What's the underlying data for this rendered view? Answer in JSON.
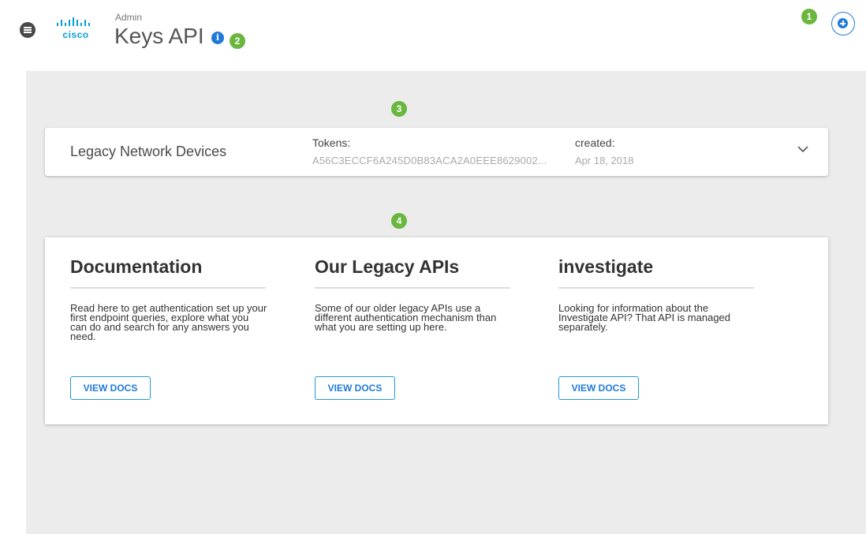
{
  "header": {
    "logo_text": "cisco",
    "section_label": "Admin",
    "title": "Keys API",
    "info_icon": "i",
    "menu_icon": "hamburger-menu-icon",
    "add_icon": "plus-circle-icon",
    "badges": [
      "1",
      "2"
    ]
  },
  "steps": [
    "3",
    "4"
  ],
  "key_row": {
    "name": "Legacy Network Devices",
    "tokens_label": "Tokens:",
    "tokens_value": "A56C3ECCF6A245D0B83ACA2A0EEE8629002...",
    "created_label": "created:",
    "created_value": "Apr 18, 2018",
    "expand_icon": "chevron-down-icon"
  },
  "docs": [
    {
      "title": "Documentation",
      "description": "Read here to get authentication set up your first endpoint queries, explore what you can do and search for any answers you need.",
      "button": "VIEW DOCS"
    },
    {
      "title": "Our Legacy APIs",
      "description": "Some of our older legacy APIs use a different authentication mechanism than what you are setting up here.",
      "button": "VIEW DOCS"
    },
    {
      "title": "investigate",
      "description": "Looking for information about the Investigate API? That API is managed separately.",
      "button": "VIEW DOCS"
    }
  ],
  "colors": {
    "accent_blue": "#1f7bd6",
    "badge_green": "#6ab63f",
    "background_gray": "#ececec"
  }
}
